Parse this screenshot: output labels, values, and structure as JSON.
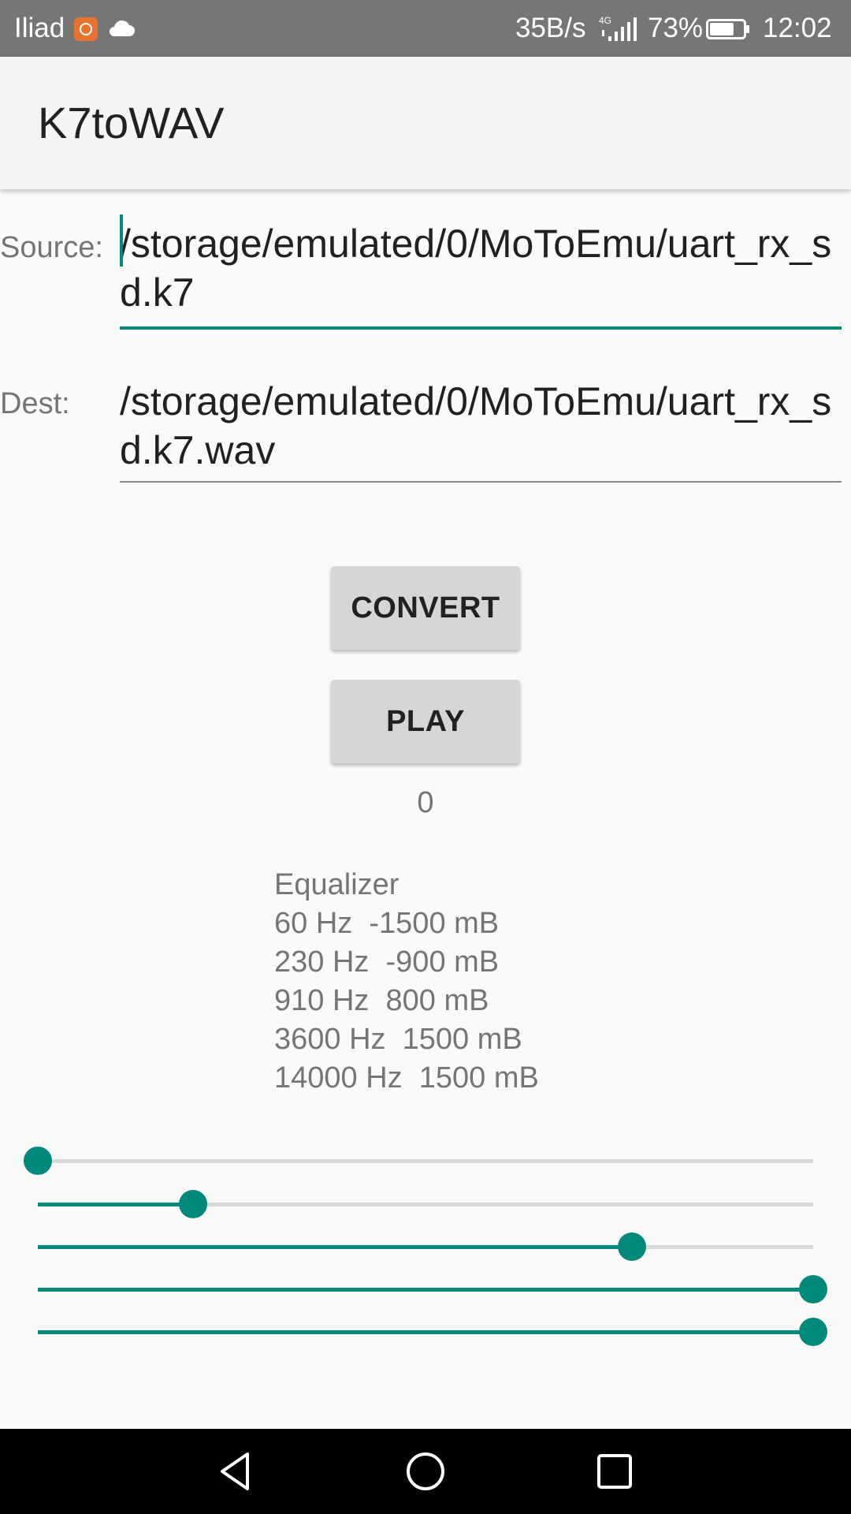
{
  "status_bar": {
    "carrier": "Iliad",
    "net_speed": "35B/s",
    "battery_percent": "73%",
    "time": "12:02",
    "battery_level": 0.73,
    "icons": [
      "mi-app-icon",
      "cloud-icon",
      "4g-signal-icon",
      "battery-icon"
    ]
  },
  "app_bar": {
    "title": "K7toWAV"
  },
  "form": {
    "source_label": "Source:",
    "source_value": "/storage/emulated/0/MoToEmu/uart_rx_sd.k7",
    "dest_label": "Dest:",
    "dest_value": "/storage/emulated/0/MoToEmu/uart_rx_sd.k7.wav"
  },
  "buttons": {
    "convert": "CONVERT",
    "play": "PLAY"
  },
  "counter": "0",
  "equalizer": {
    "title": "Equalizer",
    "bands": [
      {
        "freq": "60 Hz",
        "level": "-1500 mB",
        "text": "60 Hz  -1500 mB",
        "slider_fraction": 0.0
      },
      {
        "freq": "230 Hz",
        "level": "-900 mB",
        "text": "230 Hz  -900 mB",
        "slider_fraction": 0.2
      },
      {
        "freq": "910 Hz",
        "level": "800 mB",
        "text": "910 Hz  800 mB",
        "slider_fraction": 0.7667
      },
      {
        "freq": "3600 Hz",
        "level": "1500 mB",
        "text": "3600 Hz  1500 mB",
        "slider_fraction": 1.0
      },
      {
        "freq": "14000 Hz",
        "level": "1500 mB",
        "text": "14000 Hz  1500 mB",
        "slider_fraction": 1.0
      }
    ]
  },
  "colors": {
    "accent": "#00897b",
    "status_bar": "#767676",
    "app_bar": "#f5f5f5",
    "button": "#d6d6d6",
    "nav_bar": "#000000"
  },
  "nav_bar": {
    "icons": [
      "back-icon",
      "home-icon",
      "recents-icon"
    ]
  }
}
